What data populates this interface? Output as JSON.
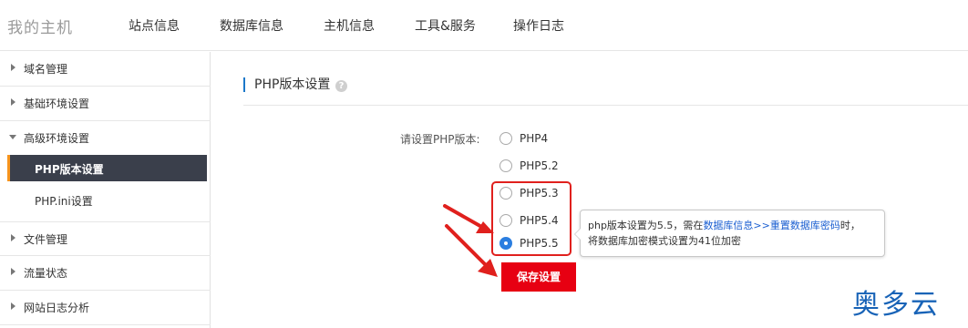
{
  "header": {
    "logo": "我的主机",
    "nav": [
      "站点信息",
      "数据库信息",
      "主机信息",
      "工具&服务",
      "操作日志"
    ]
  },
  "sidebar": {
    "items": [
      "域名管理",
      "基础环境设置",
      "高级环境设置",
      "文件管理",
      "流量状态",
      "网站日志分析"
    ],
    "subitems": [
      "PHP版本设置",
      "PHP.ini设置"
    ]
  },
  "main": {
    "section_title": "PHP版本设置",
    "help_icon": "?",
    "form_label": "请设置PHP版本:",
    "options": [
      "PHP4",
      "PHP5.2",
      "PHP5.3",
      "PHP5.4",
      "PHP5.5"
    ],
    "selected": "PHP5.5",
    "tooltip": {
      "text_before": "php版本设置为5.5，需在",
      "link": "数据库信息>>重置数据库密码",
      "text_after": "时，",
      "line2": "将数据库加密模式设置为41位加密"
    },
    "save_label": "保存设置"
  },
  "watermark": "奥多云",
  "colors": {
    "accent_red": "#e70012",
    "sidebar_active_bg": "#3a3f4b",
    "sidebar_active_marker": "#f7941d",
    "link_blue": "#1b5fd1",
    "radio_checked": "#2b7ee0"
  }
}
